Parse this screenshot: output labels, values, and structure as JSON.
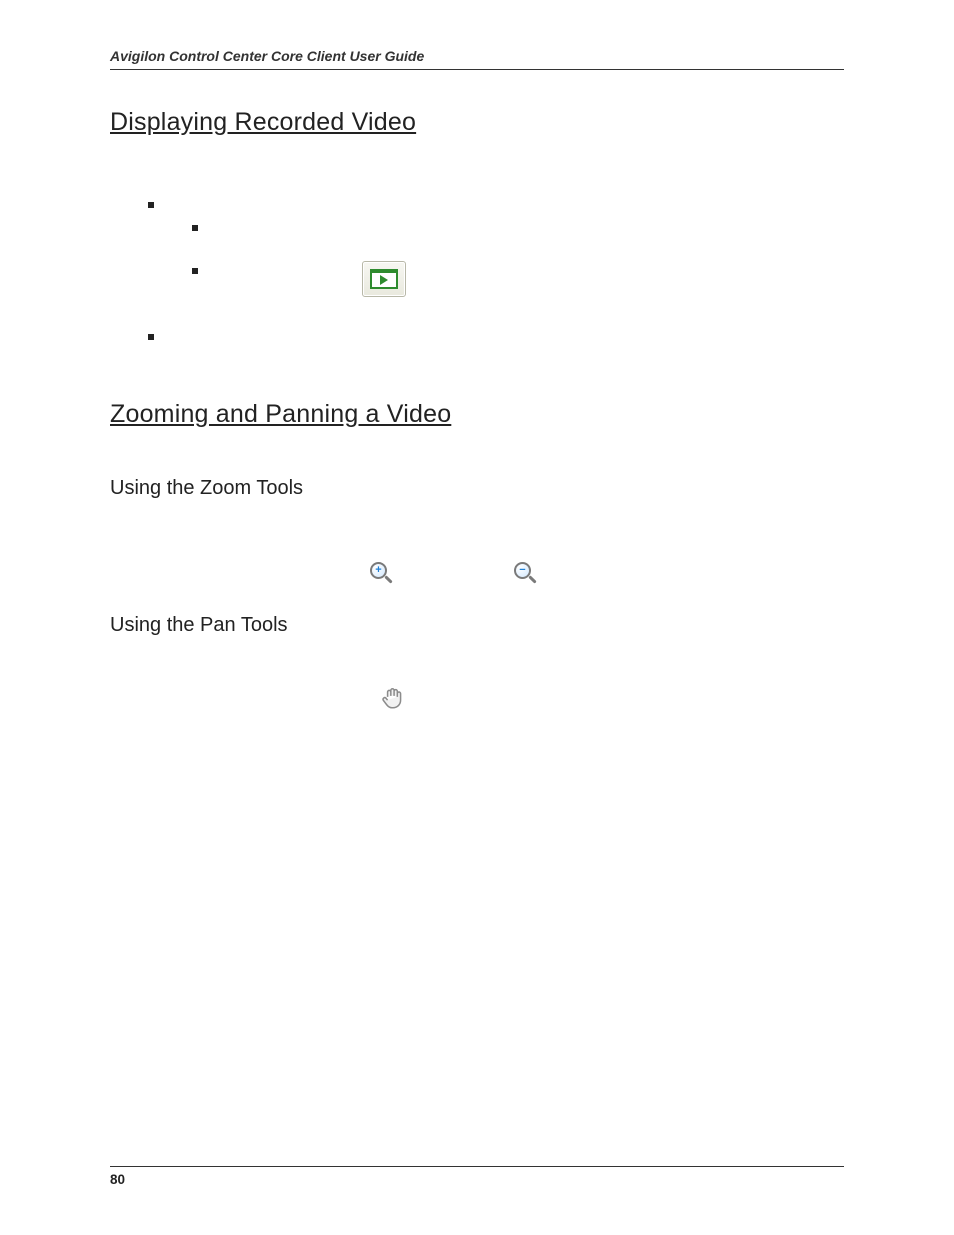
{
  "header": {
    "title": "Avigilon Control Center Core Client User Guide"
  },
  "sections": {
    "recorded": {
      "title": "Displaying Recorded Video",
      "intro1": "",
      "intro2": "",
      "bullets": {
        "b1": "",
        "sb1": "",
        "sb2_pre": "",
        "sb2_post": "",
        "b2": ""
      }
    },
    "zoompan": {
      "title": "Zooming and Panning a Video",
      "intro": "",
      "zoom": {
        "title": "Using the Zoom Tools",
        "p1": "",
        "step1": "",
        "step2_pre": "",
        "step2_mid": "",
        "step2_post": "",
        "step3": ""
      },
      "pan": {
        "title": "Using the Pan Tools",
        "p1": "",
        "step1": "",
        "step2_pre": "",
        "step2_post": ""
      }
    }
  },
  "icons": {
    "play": "play-window-icon",
    "zoom_in": "zoom-in-icon",
    "zoom_out": "zoom-out-icon",
    "pan": "pan-hand-icon"
  },
  "footer": {
    "page": "80"
  }
}
